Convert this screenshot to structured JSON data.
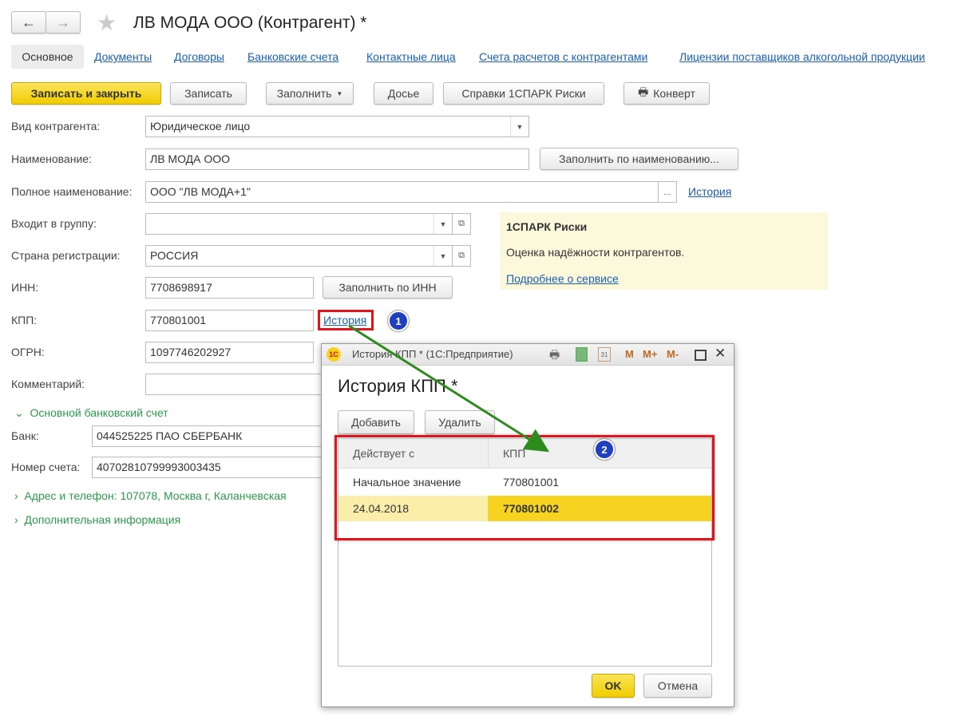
{
  "window": {
    "title": "ЛВ МОДА ООО (Контрагент) *"
  },
  "tabs": [
    "Основное",
    "Документы",
    "Договоры",
    "Банковские счета",
    "Контактные лица",
    "Счета расчетов с контрагентами",
    "Лицензии поставщиков алкогольной продукции"
  ],
  "toolbar": {
    "save_close": "Записать и закрыть",
    "save": "Записать",
    "fill": "Заполнить",
    "dossier": "Досье",
    "spark": "Справки 1СПАРК Риски",
    "envelope": "Конверт"
  },
  "form": {
    "kind_label": "Вид контрагента:",
    "kind_value": "Юридическое лицо",
    "name_label": "Наименование:",
    "name_value": "ЛВ МОДА ООО",
    "fill_by_name": "Заполнить по наименованию...",
    "full_name_label": "Полное наименование:",
    "full_name_value": "ООО \"ЛВ МОДА+1\"",
    "full_name_more": "...",
    "history": "История",
    "group_label": "Входит в группу:",
    "group_value": "",
    "country_label": "Страна регистрации:",
    "country_value": "РОССИЯ",
    "inn_label": "ИНН:",
    "inn_value": "7708698917",
    "fill_by_inn": "Заполнить по ИНН",
    "kpp_label": "КПП:",
    "kpp_value": "770801001",
    "kpp_history": "История",
    "ogrn_label": "ОГРН:",
    "ogrn_value": "1097746202927",
    "comment_label": "Комментарий:",
    "comment_value": "",
    "bank_section": "Основной банковский счет",
    "bank_label": "Банк:",
    "bank_value": "044525225 ПАО СБЕРБАНК",
    "account_label": "Номер счета:",
    "account_value": "40702810799993003435",
    "address_section": "Адрес и телефон: 107078, Москва г, Каланчевская",
    "extra_section": "Дополнительная информация"
  },
  "spark": {
    "title": "1СПАРК Риски",
    "text": "Оценка надёжности контрагентов.",
    "link": "Подробнее о сервисе"
  },
  "badges": [
    "1",
    "2"
  ],
  "dialog": {
    "window_title": "История КПП * (1С:Предприятие)",
    "title_buttons": [
      "M",
      "M+",
      "M-"
    ],
    "heading": "История КПП *",
    "add": "Добавить",
    "delete": "Удалить",
    "columns": [
      "Действует с",
      "КПП"
    ],
    "rows": [
      [
        "Начальное значение",
        "770801001"
      ],
      [
        "24.04.2018",
        "770801002"
      ]
    ],
    "ok": "OK",
    "cancel": "Отмена"
  },
  "colors": {
    "accent_yellow": "#f5d320",
    "link": "#1a5fb4",
    "section_green": "#2a9a4a",
    "highlight_red": "#e0141e",
    "arrow_green": "#2e8b1e"
  }
}
